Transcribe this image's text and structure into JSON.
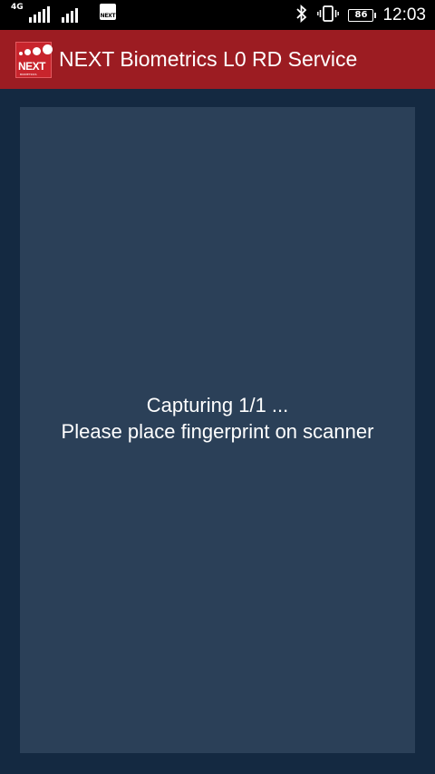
{
  "status_bar": {
    "network_type": "4G",
    "notification_app": "NEXT",
    "bluetooth_icon": "bluetooth-icon",
    "vibrate_icon": "vibrate-icon",
    "battery_level": "86",
    "time": "12:03"
  },
  "app_bar": {
    "logo_text": "NEXT",
    "logo_subtext": "BIOMETRICS",
    "title": "NEXT Biometrics L0 RD Service"
  },
  "capture": {
    "status_line": "Capturing 1/1 ...",
    "instruction_line": "Please place fingerprint on scanner"
  },
  "colors": {
    "app_bar": "#9c1c22",
    "background": "#142941",
    "panel": "#2b4058"
  }
}
